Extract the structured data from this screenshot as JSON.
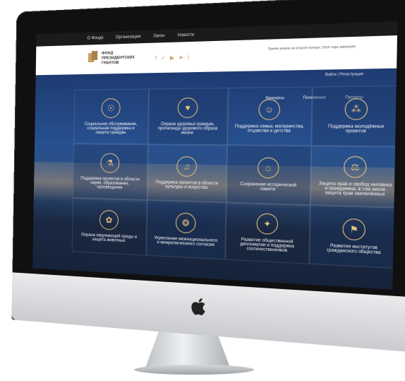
{
  "top_nav": [
    "О Фонде",
    "Организации",
    "Закон",
    "Новости"
  ],
  "logo": {
    "line1": "ФОНД",
    "line2": "ПРЕЗИДЕНТСКИХ",
    "line3": "ГРАНТОВ"
  },
  "socials": [
    "f",
    "vk",
    "yt",
    "tg",
    "i"
  ],
  "header_note": "Приём заявок на второй конкурс 2018 года завершён",
  "login": "Войти | Регистрация",
  "hero_tabs": [
    "Конкурсы",
    "Положение",
    "Проекты"
  ],
  "categories": [
    "Социальное обслуживание, социальная поддержка и защита граждан",
    "Охрана здоровья граждан, пропаганда здорового образа жизни",
    "Поддержка семьи, материнства, отцовства и детства",
    "Поддержка молодёжных проектов",
    "Поддержка проектов в области науки, образования, просвещения",
    "Поддержка проектов в области культуры и искусства",
    "Сохранение исторической памяти",
    "Защита прав и свобод человека и гражданина, в том числе защита прав заключённых",
    "Охрана окружающей среды и защита животных",
    "Укрепление межнационального и межрелигиозного согласия",
    "Развитие общественной дипломатии и поддержка соотечественников",
    "Развитие институтов гражданского общества"
  ]
}
